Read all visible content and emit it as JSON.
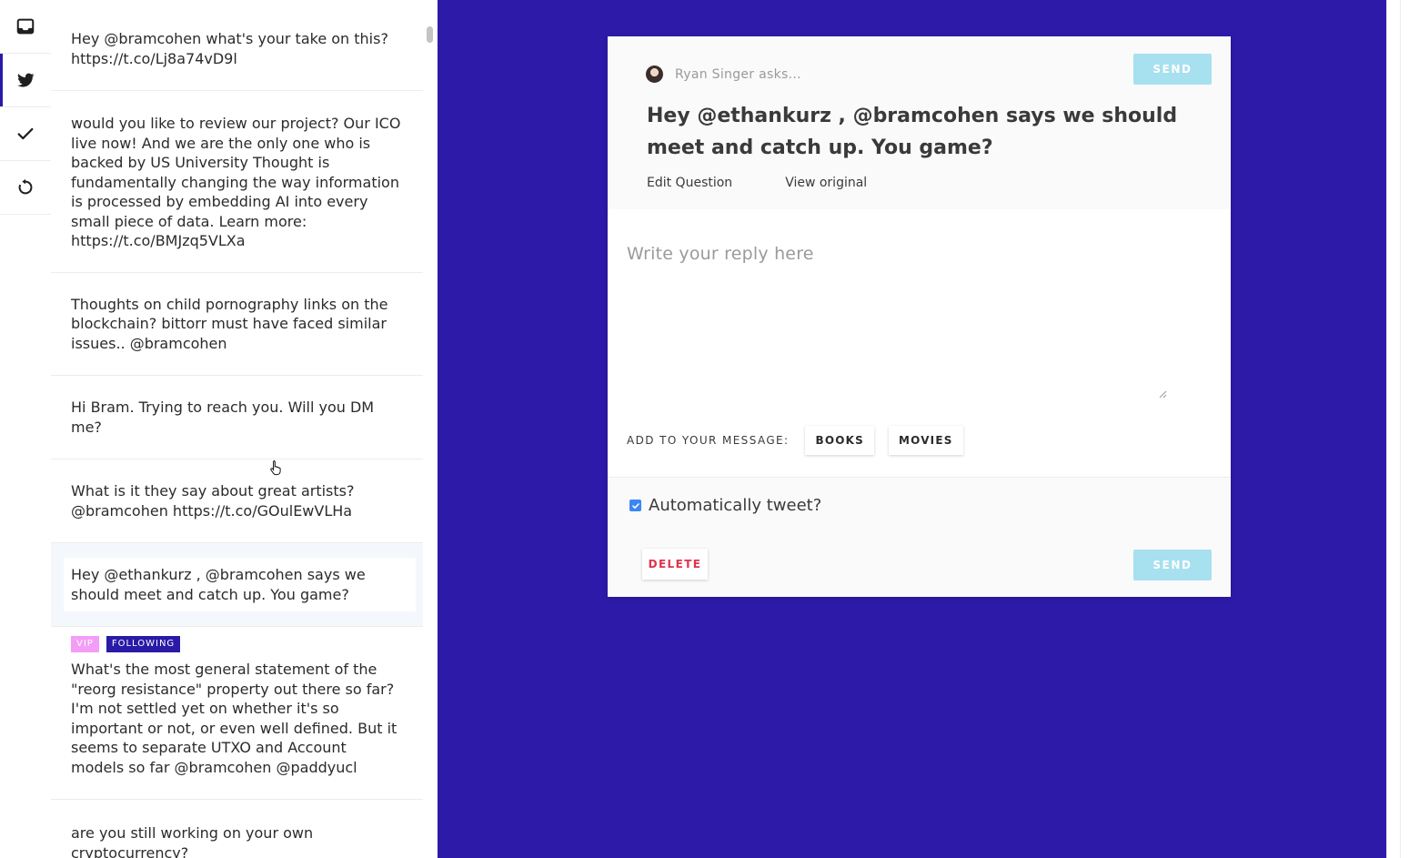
{
  "rail": {
    "icons": [
      "inbox-icon",
      "twitter-icon",
      "check-icon",
      "refresh-icon"
    ],
    "active": "twitter-icon",
    "accent": "#2a1aa7"
  },
  "messages": [
    {
      "text": "Hey @bramcohen what's your take on this? https://t.co/Lj8a74vD9l"
    },
    {
      "text": "would you like to review our project? Our ICO live now! And we are the only one who is backed by US University Thought is fundamentally changing the way information is processed by embedding AI into every small piece of data. Learn more: https://t.co/BMJzq5VLXa"
    },
    {
      "text": "Thoughts on child pornography links on the blockchain? bittorr must have faced similar issues.. @bramcohen"
    },
    {
      "text": "Hi Bram. Trying to reach you. Will you DM me?"
    },
    {
      "text": "What is it they say about great artists? @bramcohen https://t.co/GOulEwVLHa"
    },
    {
      "text": "Hey @ethankurz , @bramcohen says we should meet and catch up. You game?"
    },
    {
      "text": "What's the most general statement of the \"reorg resistance\" property out there so far? I'm not settled yet on whether it's so important or not, or even well defined. But it seems to separate UTXO and Account models so far @bramcohen @paddyucl",
      "badges": [
        "VIP",
        "FOLLOWING"
      ]
    },
    {
      "text": "are you still working on your own cryptocurrency?"
    }
  ],
  "card": {
    "asker": "Ryan Singer asks...",
    "question": "Hey @ethankurz , @bramcohen says we should meet and catch up. You game?",
    "edit_question": "Edit Question",
    "view_original": "View original",
    "send_label": "SEND",
    "reply_placeholder": "Write your reply here",
    "add_label": "ADD TO YOUR MESSAGE:",
    "chips": [
      "BOOKS",
      "MOVIES"
    ],
    "auto_tweet_label": "Automatically tweet?",
    "auto_tweet_checked": true,
    "delete_label": "DELETE"
  },
  "colors": {
    "panel_bg": "#2d1aa9",
    "send_bg": "#a7e0ef",
    "delete_fg": "#e0334b",
    "checkbox": "#3b86f5",
    "vip_badge": "#f39df6",
    "following_badge": "#2a1aa7"
  }
}
